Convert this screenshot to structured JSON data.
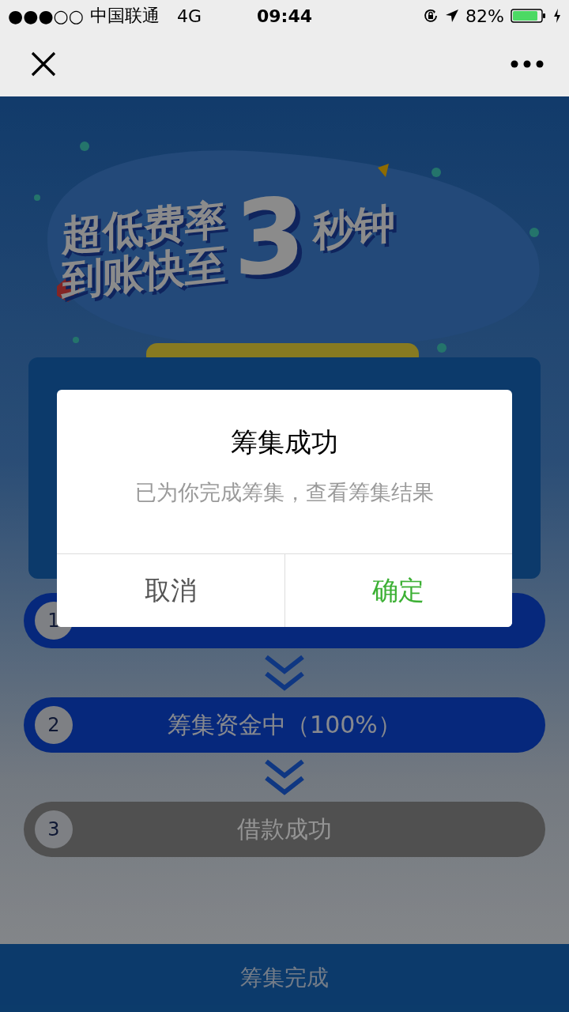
{
  "status_bar": {
    "signal": "●●●○○",
    "carrier": "中国联通",
    "network": "4G",
    "time": "09:44",
    "battery": "82%"
  },
  "banner": {
    "line_1": "超低费率",
    "line_2": "到账快至",
    "digit": "3",
    "line_3": "秒钟"
  },
  "steps": [
    {
      "number": "1",
      "active": true
    },
    {
      "number": "2",
      "label": "筹集资金中（100%）",
      "active": true
    },
    {
      "number": "3",
      "label": "借款成功",
      "active": false
    }
  ],
  "footer_button": "筹集完成",
  "dialog": {
    "title": "筹集成功",
    "message": "已为你完成筹集，查看筹集结果",
    "buttons": [
      {
        "label": "取消",
        "kind": "cancel"
      },
      {
        "label": "确定",
        "kind": "confirm"
      }
    ]
  }
}
